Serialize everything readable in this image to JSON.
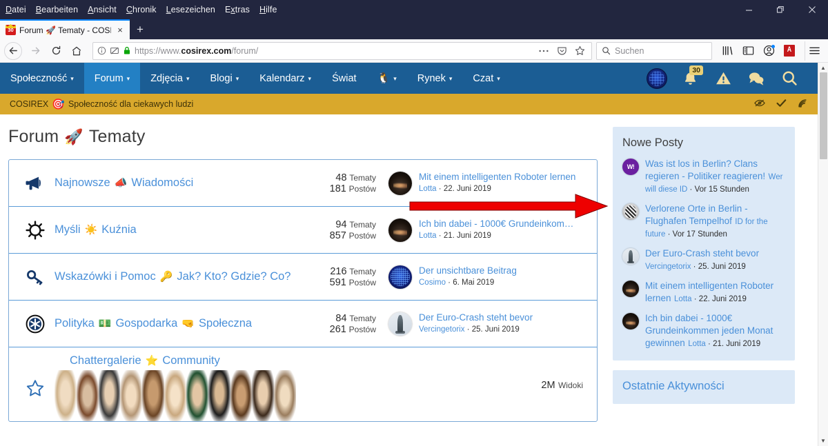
{
  "browser": {
    "menu": [
      "Datei",
      "Bearbeiten",
      "Ansicht",
      "Chronik",
      "Lesezeichen",
      "Extras",
      "Hilfe"
    ],
    "window_controls": {
      "minimize": "minimize-icon",
      "restore": "restore-icon",
      "close": "close-icon"
    },
    "tab": {
      "title": "Forum 🚀 Tematy - COSIREX",
      "favicon_badge": "30",
      "close_label": "×"
    },
    "new_tab_label": "+",
    "url": {
      "prefix": "https://www.",
      "domain": "cosirex.com",
      "path": "/forum/"
    },
    "search": {
      "placeholder": "Suchen"
    },
    "toolbar_icons": [
      "library-icon",
      "sidebar-icon",
      "account-icon",
      "pdf-icon",
      "hamburger-menu-icon"
    ]
  },
  "site": {
    "nav": [
      {
        "label": "Społeczność",
        "caret": true,
        "active": false
      },
      {
        "label": "Forum",
        "caret": true,
        "active": true
      },
      {
        "label": "Zdjęcia",
        "caret": true,
        "active": false
      },
      {
        "label": "Blogi",
        "caret": true,
        "active": false
      },
      {
        "label": "Kalendarz",
        "caret": true,
        "active": false
      },
      {
        "label": "Świat",
        "caret": false,
        "active": false
      },
      {
        "label": "🐧",
        "caret": true,
        "active": false
      },
      {
        "label": "Rynek",
        "caret": true,
        "active": false
      },
      {
        "label": "Czat",
        "caret": true,
        "active": false
      }
    ],
    "nav_right": {
      "avatar": "globe-avatar",
      "notifications_badge": "30",
      "icons": [
        "bell-icon",
        "alert-icon",
        "chat-icon",
        "search-icon"
      ]
    },
    "goldbar": {
      "brand": "COSIREX",
      "brand_emoji": "🎯",
      "tagline": "Społeczność dla ciekawych ludzi",
      "right_icons": [
        "eye-off-icon",
        "check-icon",
        "rss-icon"
      ]
    },
    "accent_blue": "#4a90d9",
    "nav_blue": "#1b5d94",
    "nav_active_blue": "#2380c4",
    "gold": "#d9a82c",
    "sidebar_bg": "#dce9f7",
    "arrow_color": "#ee0000"
  },
  "page": {
    "title": "Forum",
    "title_emoji": "🚀",
    "title_suffix": "Tematy",
    "forums": [
      {
        "icon": "megaphone-icon",
        "title_a": "Najnowsze",
        "title_emoji": "📣",
        "title_b": "Wiadomości",
        "topics_count": "48",
        "topics_label": "Tematy",
        "posts_count": "181",
        "posts_label": "Postów",
        "last_title": "Mit einem intelligenten Roboter lernen",
        "last_author": "Lotta",
        "last_date": "22. Juni 2019",
        "avatar": "av-dark"
      },
      {
        "icon": "gear-sun-icon",
        "title_a": "Myśli",
        "title_emoji": "☀️",
        "title_b": "Kuźnia",
        "topics_count": "94",
        "topics_label": "Tematy",
        "posts_count": "857",
        "posts_label": "Postów",
        "last_title": "Ich bin dabei - 1000€ Grundeinkom…",
        "last_author": "Lotta",
        "last_date": "21. Juni 2019",
        "avatar": "av-dark"
      },
      {
        "icon": "key-icon",
        "title_a": "Wskazówki i Pomoc",
        "title_emoji": "🔑",
        "title_b": "Jak? Kto? Gdzie? Co?",
        "topics_count": "216",
        "topics_label": "Tematy",
        "posts_count": "591",
        "posts_label": "Postów",
        "last_title": "Der unsichtbare Beitrag",
        "last_author": "Cosimo",
        "last_date": "6. Mai 2019",
        "avatar": "av-globe"
      },
      {
        "icon": "empire-star-icon",
        "title_a": "Polityka",
        "title_emoji": "💵",
        "title_b": "Gospodarka",
        "title_emoji2": "🤜",
        "title_c": "Społeczna",
        "topics_count": "84",
        "topics_label": "Tematy",
        "posts_count": "261",
        "posts_label": "Postów",
        "last_title": "Der Euro-Crash steht bevor",
        "last_author": "Vercingetorix",
        "last_date": "25. Juni 2019",
        "avatar": "av-statue"
      }
    ],
    "gallery": {
      "icon": "star-outline-icon",
      "title_a": "Chattergalerie",
      "title_emoji": "⭐",
      "title_b": "Community",
      "views_count": "2M",
      "views_label": "Widoki"
    }
  },
  "sidebar": {
    "new_posts": {
      "heading": "Nowe Posty",
      "items": [
        {
          "title": "Was ist los in Berlin? Clans regieren - Politiker reagieren!",
          "author": "Wer will diese ID",
          "time": "Vor 15 Stunden",
          "avatar": "av-purple",
          "avatar_initials": "W!"
        },
        {
          "title": "Verlorene Orte in Berlin - Flughafen Tempelhof",
          "author": "ID for the future",
          "time": "Vor 17 Stunden",
          "avatar": "av-helmet"
        },
        {
          "title": "Der Euro-Crash steht bevor",
          "author": "Vercingetorix",
          "time": "25. Juni 2019",
          "avatar": "av-statue"
        },
        {
          "title": "Mit einem intelligenten Roboter lernen",
          "author": "Lotta",
          "time": "22. Juni 2019",
          "avatar": "av-dark"
        },
        {
          "title": "Ich bin dabei - 1000€ Grundeinkommen jeden Monat gewinnen",
          "author": "Lotta",
          "time": "21. Juni 2019",
          "avatar": "av-dark"
        }
      ]
    },
    "recent_activity": {
      "heading": "Ostatnie Aktywności"
    }
  }
}
